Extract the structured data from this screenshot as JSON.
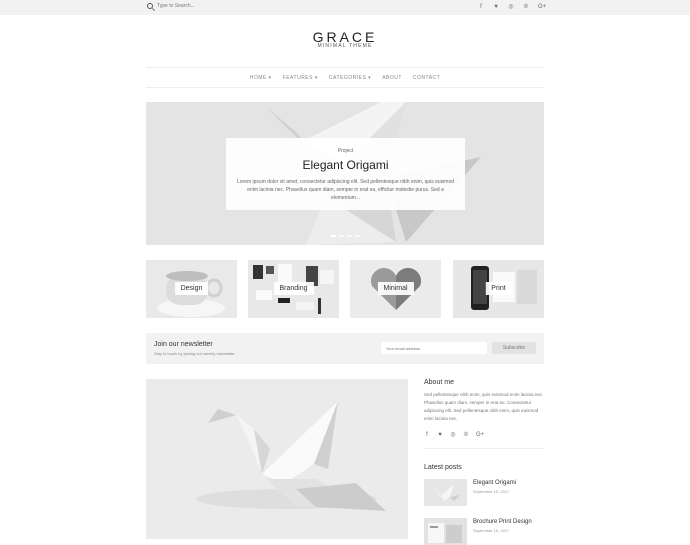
{
  "topbar": {
    "search_placeholder": "Type to Search...",
    "social": [
      {
        "icon": "facebook-icon",
        "glyph": "f"
      },
      {
        "icon": "twitter-icon",
        "glyph": "♥"
      },
      {
        "icon": "instagram-icon",
        "glyph": "◎"
      },
      {
        "icon": "pinterest-icon",
        "glyph": "℗"
      },
      {
        "icon": "google-plus-icon",
        "glyph": "G+"
      }
    ]
  },
  "brand": {
    "title": "GRACE",
    "tagline": "MINIMAL THEME"
  },
  "nav": {
    "items": [
      "HOME ▾",
      "FEATURES ▾",
      "CATEGORIES ▾",
      "ABOUT",
      "CONTACT"
    ]
  },
  "hero": {
    "kicker": "Project",
    "title": "Elegant Origami",
    "excerpt": "Lorem ipsum dolor sit amet, consectetur adipiscing elit. Sed pellentesque nibh enim, quis euismod enim lacinia nec. Phasellus quam diam, semper in erat eu, efficitur molestie purus. Sed a elementum...",
    "slide_count": 4,
    "active_slide": 1
  },
  "categories": [
    "Design",
    "Branding",
    "Minimal",
    "Print"
  ],
  "newsletter": {
    "title": "Join our newsletter",
    "subtitle": "Stay in touch by joining our weekly newsletter",
    "email_placeholder": "Your email address",
    "button": "Subscribe"
  },
  "sidebar": {
    "about_title": "About me",
    "about_text": "Sed pellentesque nibh enim, quis euismod enim lacinia nec. Phasellus quam diam, semper in erat eu. Consectetur adipiscing elit. Sed pellentesque nibh enim, quis euismod enim lacinia nec.",
    "about_social": [
      {
        "icon": "facebook-icon",
        "glyph": "f"
      },
      {
        "icon": "twitter-icon",
        "glyph": "♥"
      },
      {
        "icon": "instagram-icon",
        "glyph": "◎"
      },
      {
        "icon": "pinterest-icon",
        "glyph": "℗"
      },
      {
        "icon": "google-plus-icon",
        "glyph": "G+"
      }
    ],
    "latest_title": "Latest posts",
    "posts": [
      {
        "title": "Elegant Origami",
        "date": "September 15, 2017"
      },
      {
        "title": "Brochure Print Design",
        "date": "September 15, 2017"
      }
    ]
  }
}
